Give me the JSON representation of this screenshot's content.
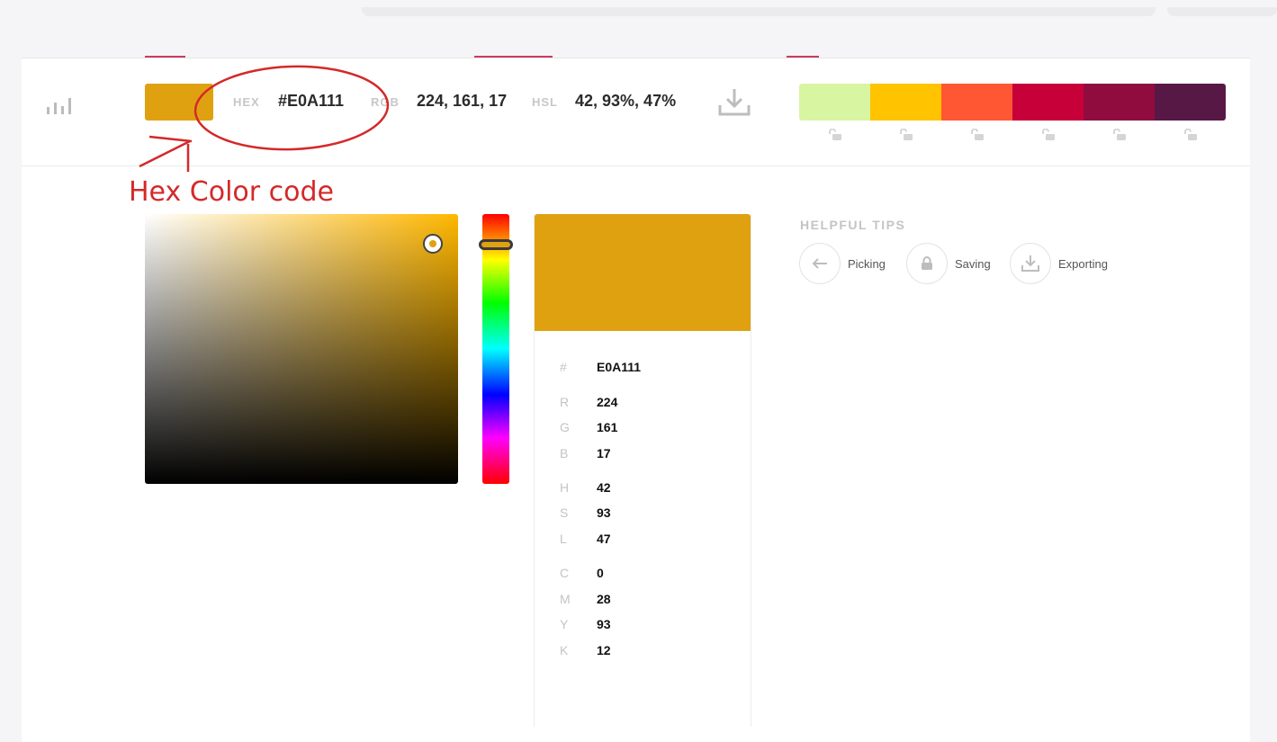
{
  "current_color": {
    "swatch_color": "#E0A111",
    "hex_label": "HEX",
    "hex_value": "#E0A111",
    "rgb_label": "RGB",
    "rgb_value": "224, 161, 17",
    "hsl_label": "HSL",
    "hsl_value": "42, 93%, 47%"
  },
  "palette": [
    "#D8F5A2",
    "#FFC300",
    "#FF5733",
    "#C70039",
    "#900C3F",
    "#581845"
  ],
  "annotation": {
    "text": "Hex Color code",
    "color": "#D42929"
  },
  "picker": {
    "hue_color": "#FFB700"
  },
  "details": {
    "rows": [
      {
        "key": "#",
        "value": "E0A111"
      },
      {
        "key": "R",
        "value": "224"
      },
      {
        "key": "G",
        "value": "161"
      },
      {
        "key": "B",
        "value": "17"
      },
      {
        "key": "H",
        "value": "42"
      },
      {
        "key": "S",
        "value": "93"
      },
      {
        "key": "L",
        "value": "47"
      },
      {
        "key": "C",
        "value": "0"
      },
      {
        "key": "M",
        "value": "28"
      },
      {
        "key": "Y",
        "value": "93"
      },
      {
        "key": "K",
        "value": "12"
      }
    ]
  },
  "tips": {
    "title": "HELPFUL TIPS",
    "items": [
      {
        "label": "Picking",
        "icon": "arrow-left-icon"
      },
      {
        "label": "Saving",
        "icon": "lock-icon"
      },
      {
        "label": "Exporting",
        "icon": "download-icon"
      }
    ]
  }
}
